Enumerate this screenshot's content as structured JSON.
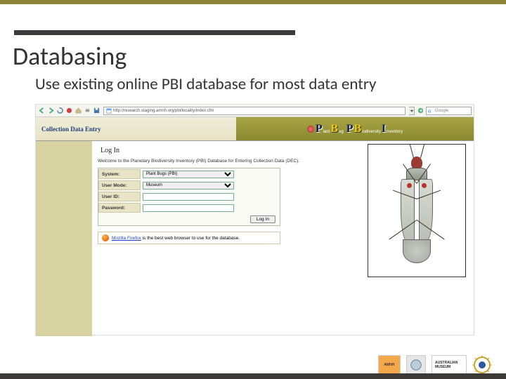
{
  "slide": {
    "title": "Databasing",
    "subtitle": "Use existing online PBI database for most data entry"
  },
  "browser": {
    "url": "http://research.staging.amnh.org/pbi/locality/index.cfm",
    "search_engine": "Google",
    "nav_icons": [
      "back-icon",
      "forward-icon",
      "reload-icon",
      "stop-icon",
      "home-icon",
      "print-icon",
      "save-icon"
    ]
  },
  "page": {
    "header_left": "Collection Data Entry",
    "logo_words": {
      "p": "P",
      "lant": "lant",
      "b": "B",
      "ug": "ug",
      "pl": "P",
      "bi": "B",
      "iod": "iodiversity",
      "i": "I",
      "nv": "nventory"
    },
    "login_heading": "Log In",
    "welcome": "Welcome to the Planetary Biodiversity Inventory (PBI) Database for Entering Collection Data (DEC).",
    "form": {
      "system_label": "System:",
      "system_value": "Plant Bugs (PBI)",
      "mode_label": "User Mode:",
      "mode_value": "Museum",
      "userid_label": "User ID:",
      "userid_value": "",
      "password_label": "Password:",
      "password_value": "",
      "login_button": "Log In"
    },
    "firefox_note_link": "Mozilla Firefox",
    "firefox_note_rest": " is the best web browser to use for the database.",
    "side_image_alt": "Plant bug illustration"
  },
  "footer": {
    "logo1": "AMNH",
    "logo2": "",
    "logo3": "AUSTRALIAN MUSEUM",
    "logo4": ""
  }
}
